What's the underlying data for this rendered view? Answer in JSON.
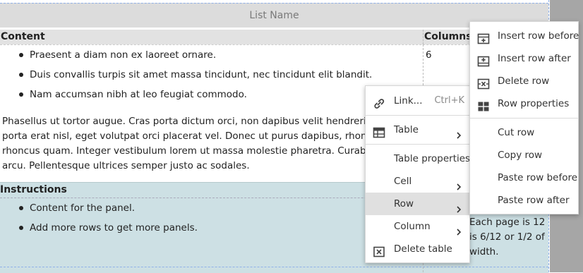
{
  "list_name": "List Name",
  "table": {
    "header_content": "Content",
    "header_columns": "Columns",
    "row1": {
      "bullets": [
        "Praesent a diam non ex laoreet ornare.",
        "Duis convallis turpis sit amet massa tincidunt, nec tincidunt elit blandit.",
        "Nam accumsan nibh at leo feugiat commodo."
      ],
      "paragraph_lines": [
        "Phasellus ut tortor augue. Cras porta dictum orci, non dapibus velit hendrerit e",
        "porta erat nisl, eget volutpat orci placerat vel. Donec ut purus dapibus, rhoncus",
        "rhoncus quam. Integer vestibulum lorem ut massa molestie pharetra. Curabitu",
        "arcu. Pellentesque ultrices semper justo ac sodales."
      ],
      "columns_value": "6"
    },
    "row2": {
      "header": "Instructions",
      "bullets": [
        "Content for the panel.",
        "Add more rows to get more panels."
      ],
      "columns_text_lines": [
        "Each page is 12",
        "is 6/12 or 1/2 of",
        "width."
      ]
    }
  },
  "context_menu": {
    "items": {
      "link": {
        "label": "Link...",
        "shortcut": "Ctrl+K",
        "icon": "link-icon"
      },
      "table": {
        "label": "Table",
        "icon": "table-icon"
      },
      "table_properties": {
        "label": "Table properties"
      },
      "cell": {
        "label": "Cell"
      },
      "row": {
        "label": "Row"
      },
      "column": {
        "label": "Column"
      },
      "delete_table": {
        "label": "Delete table",
        "icon": "delete-table-icon"
      }
    }
  },
  "row_submenu": {
    "items": {
      "insert_before": {
        "label": "Insert row before",
        "icon": "insert-row-before-icon"
      },
      "insert_after": {
        "label": "Insert row after",
        "icon": "insert-row-after-icon"
      },
      "delete_row": {
        "label": "Delete row",
        "icon": "delete-row-icon"
      },
      "row_properties": {
        "label": "Row properties",
        "icon": "row-properties-icon"
      },
      "cut_row": {
        "label": "Cut row"
      },
      "copy_row": {
        "label": "Copy row"
      },
      "paste_before": {
        "label": "Paste row before"
      },
      "paste_after": {
        "label": "Paste row after"
      }
    }
  },
  "colors": {
    "highlight": "#e0e0e0",
    "panel_row_bg": "#cde0e4",
    "header_bg": "#e2e2e2"
  }
}
